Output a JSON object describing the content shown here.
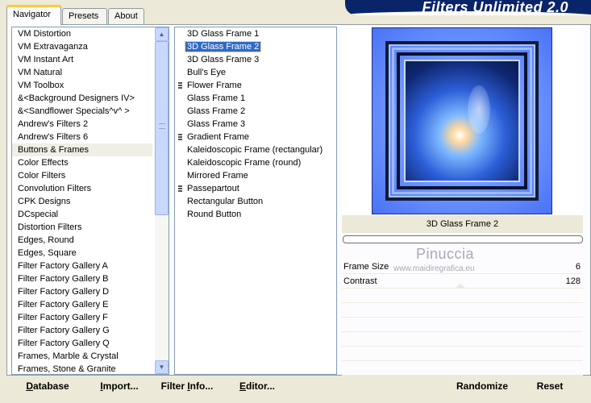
{
  "tabs": [
    {
      "label": "Navigator",
      "active": true
    },
    {
      "label": "Presets",
      "active": false
    },
    {
      "label": "About",
      "active": false
    }
  ],
  "banner": {
    "title": "Filters Unlimited 2.0"
  },
  "categories": [
    {
      "label": "VM Distortion",
      "selected": false
    },
    {
      "label": "VM Extravaganza",
      "selected": false
    },
    {
      "label": "VM Instant Art",
      "selected": false
    },
    {
      "label": "VM Natural",
      "selected": false
    },
    {
      "label": "VM Toolbox",
      "selected": false
    },
    {
      "label": "&<Background Designers IV>",
      "selected": false
    },
    {
      "label": "&<Sandflower Specials^v^ >",
      "selected": false
    },
    {
      "label": "Andrew's Filters 2",
      "selected": false
    },
    {
      "label": "Andrew's Filters 6",
      "selected": false
    },
    {
      "label": "Buttons & Frames",
      "selected": true
    },
    {
      "label": "Color Effects",
      "selected": false
    },
    {
      "label": "Color Filters",
      "selected": false
    },
    {
      "label": "Convolution Filters",
      "selected": false
    },
    {
      "label": "CPK Designs",
      "selected": false
    },
    {
      "label": "DCspecial",
      "selected": false
    },
    {
      "label": "Distortion Filters",
      "selected": false
    },
    {
      "label": "Edges, Round",
      "selected": false
    },
    {
      "label": "Edges, Square",
      "selected": false
    },
    {
      "label": "Filter Factory Gallery A",
      "selected": false
    },
    {
      "label": "Filter Factory Gallery B",
      "selected": false
    },
    {
      "label": "Filter Factory Gallery D",
      "selected": false
    },
    {
      "label": "Filter Factory Gallery E",
      "selected": false
    },
    {
      "label": "Filter Factory Gallery F",
      "selected": false
    },
    {
      "label": "Filter Factory Gallery G",
      "selected": false
    },
    {
      "label": "Filter Factory Gallery Q",
      "selected": false
    },
    {
      "label": "Frames, Marble & Crystal",
      "selected": false
    },
    {
      "label": "Frames, Stone & Granite",
      "selected": false
    }
  ],
  "filters": [
    {
      "label": "3D Glass Frame 1",
      "selected": false,
      "marker": false
    },
    {
      "label": "3D Glass Frame 2",
      "selected": true,
      "marker": false
    },
    {
      "label": "3D Glass Frame 3",
      "selected": false,
      "marker": false
    },
    {
      "label": "Bull's Eye",
      "selected": false,
      "marker": false
    },
    {
      "label": "Flower Frame",
      "selected": false,
      "marker": true
    },
    {
      "label": "Glass Frame 1",
      "selected": false,
      "marker": false
    },
    {
      "label": "Glass Frame 2",
      "selected": false,
      "marker": false
    },
    {
      "label": "Glass Frame 3",
      "selected": false,
      "marker": false
    },
    {
      "label": "Gradient Frame",
      "selected": false,
      "marker": true
    },
    {
      "label": "Kaleidoscopic Frame (rectangular)",
      "selected": false,
      "marker": false
    },
    {
      "label": "Kaleidoscopic Frame (round)",
      "selected": false,
      "marker": false
    },
    {
      "label": "Mirrored Frame",
      "selected": false,
      "marker": false
    },
    {
      "label": "Passepartout",
      "selected": false,
      "marker": true
    },
    {
      "label": "Rectangular Button",
      "selected": false,
      "marker": false
    },
    {
      "label": "Round Button",
      "selected": false,
      "marker": false
    }
  ],
  "preview": {
    "filter_name": "3D Glass Frame 2",
    "progress": 0
  },
  "watermark": {
    "name": "Pinuccia",
    "url": "www.maidiregrafica.eu"
  },
  "params": [
    {
      "label": "Frame Size",
      "value": "6"
    },
    {
      "label": "Contrast",
      "value": "128"
    }
  ],
  "buttons": {
    "database": {
      "u": "D",
      "rest": "atabase"
    },
    "import": {
      "u": "I",
      "rest": "mport..."
    },
    "filter_info": {
      "pre": "Filter ",
      "u": "I",
      "rest": "nfo..."
    },
    "editor": {
      "u": "E",
      "rest": "ditor..."
    },
    "randomize": "Randomize",
    "reset": "Reset"
  },
  "colors": {
    "selection": "#316ac5",
    "banner": "#0a246a",
    "panel": "#ece9d8"
  }
}
